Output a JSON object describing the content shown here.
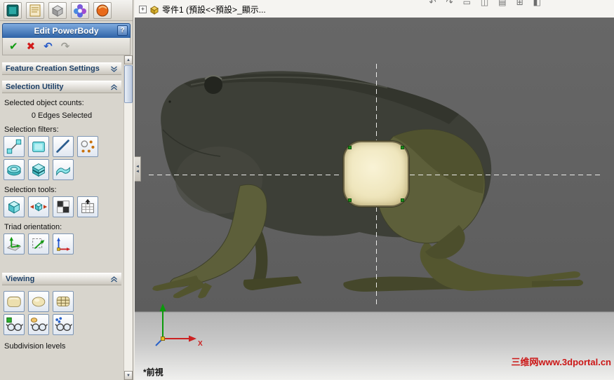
{
  "glyphs": {
    "check": "✔",
    "cross": "✖",
    "undo": "↶",
    "redo": "↷",
    "plus": "+",
    "scroll_up": "▲",
    "scroll_down": "▼",
    "collapse_left": "◄"
  },
  "panel": {
    "title": "Edit PowerBody",
    "help": "?",
    "sections": {
      "feature_creation": {
        "label": "Feature Creation Settings"
      },
      "selection_utility": {
        "label": "Selection Utility",
        "counts_label": "Selected object counts:",
        "counts_value": "0 Edges Selected",
        "filters_label": "Selection filters:",
        "tools_label": "Selection tools:",
        "triad_label": "Triad orientation:"
      },
      "viewing": {
        "label": "Viewing",
        "subdivision_label": "Subdivision levels"
      }
    },
    "icon_names": {
      "tabs": [
        "powerbody-tab",
        "notes-tab",
        "model-tab",
        "power-surfacing-tab",
        "render-tab"
      ],
      "selection_filters": [
        "vertex-filter",
        "face-filter",
        "edge-filter",
        "point-filter",
        "loop-ring-select",
        "loop-box-select",
        "loop-band-select"
      ],
      "selection_tools": [
        "volume-select",
        "grow-selection",
        "checker-select",
        "pattern-select"
      ],
      "triad_orientation": [
        "align-to-plane",
        "align-to-view",
        "align-to-world"
      ],
      "viewing": [
        "smooth-view",
        "smooth-only-view",
        "cage-view",
        "toggle-mesh",
        "toggle-surface",
        "toggle-points"
      ]
    }
  },
  "document": {
    "tree_node": "零件1 (預設<<預設>_顯示...",
    "top_toolbar_icons": [
      {
        "glyph": "↶"
      },
      {
        "glyph": "↷"
      },
      {
        "glyph": "▭"
      },
      {
        "glyph": "◫"
      },
      {
        "glyph": "▤"
      },
      {
        "glyph": "⊞"
      },
      {
        "glyph": "◧"
      }
    ]
  },
  "viewport": {
    "view_label": "*前視",
    "watermark": "三维网www.3dportal.cn",
    "triad": {
      "x_label": "X"
    },
    "colors": {
      "background": "#5e5e5e",
      "selected_face": "#efe6bd",
      "frog_body": "#3d3f37",
      "frog_limbs": "#5d5f3a",
      "crosshair": "#f0f0ee",
      "watermark": "#cc1616",
      "title_bar": "#2e62a6"
    }
  }
}
